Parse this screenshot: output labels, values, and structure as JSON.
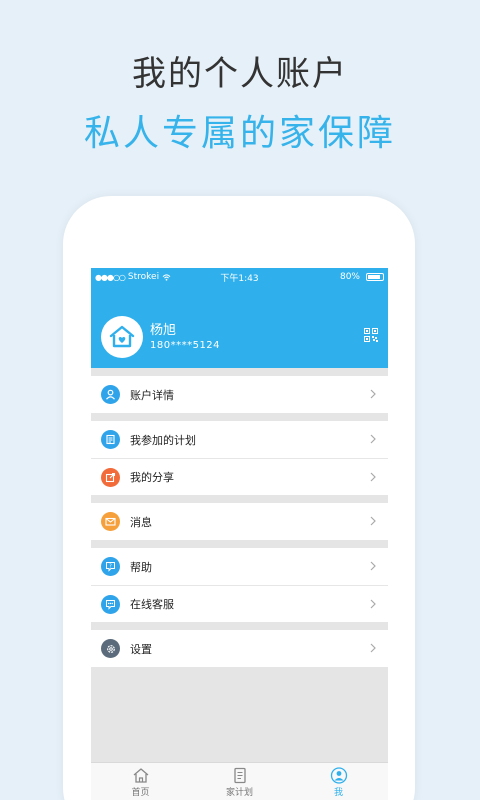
{
  "promo": {
    "title": "我的个人账户",
    "subtitle": "私人专属的家保障"
  },
  "status_bar": {
    "carrier": "Strokei",
    "signal_dots": "●●●○○",
    "time": "下午1:43",
    "battery": "80%"
  },
  "profile": {
    "name": "杨旭",
    "phone": "180****5124"
  },
  "menu": [
    {
      "label": "账户详情",
      "icon": "user-icon",
      "color": "#2fa4ea"
    },
    {
      "label": "我参加的计划",
      "icon": "plan-icon",
      "color": "#2fa4ea"
    },
    {
      "label": "我的分享",
      "icon": "share-icon",
      "color": "#f26b3a"
    },
    {
      "label": "消息",
      "icon": "mail-icon",
      "color": "#f5a03a"
    },
    {
      "label": "帮助",
      "icon": "help-icon",
      "color": "#2fa4ea"
    },
    {
      "label": "在线客服",
      "icon": "chat-icon",
      "color": "#2fa4ea"
    },
    {
      "label": "设置",
      "icon": "gear-icon",
      "color": "#5b6b7b"
    }
  ],
  "tabs": [
    {
      "label": "首页",
      "icon": "home-icon",
      "active": false
    },
    {
      "label": "家计划",
      "icon": "document-icon",
      "active": false
    },
    {
      "label": "我",
      "icon": "profile-icon",
      "active": true
    }
  ],
  "colors": {
    "accent": "#2fb0ec",
    "background": "#e6f0f8",
    "title_text": "#333333",
    "subtitle_text": "#35b3ea"
  }
}
